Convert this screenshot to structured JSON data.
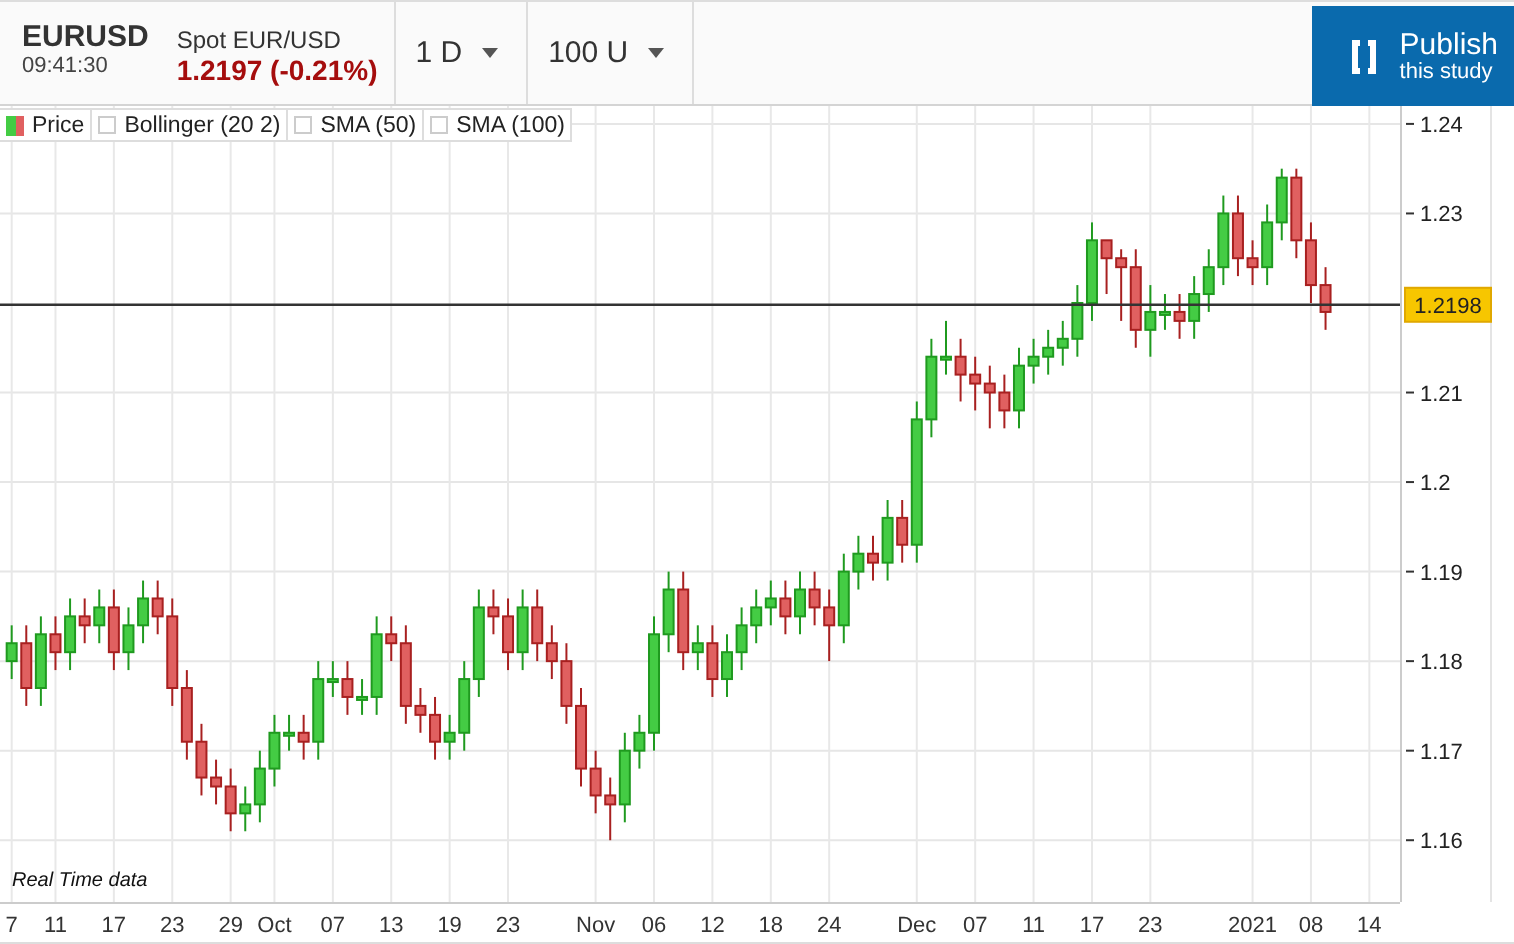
{
  "header": {
    "symbol": "EURUSD",
    "time": "09:41:30",
    "instrument": "Spot EUR/USD",
    "price": "1.2197 (-0.21%)",
    "dropdowns": [
      {
        "label": "1 D"
      },
      {
        "label": "100 U"
      }
    ],
    "publish_button": {
      "title": "Publish",
      "subtitle": "this study"
    }
  },
  "legend": [
    {
      "label": "Price",
      "kind": "swatch"
    },
    {
      "label": "Bollinger (20 2)",
      "kind": "checkbox",
      "checked": false
    },
    {
      "label": "SMA (50)",
      "kind": "checkbox",
      "checked": false
    },
    {
      "label": "SMA (100)",
      "kind": "checkbox",
      "checked": false
    }
  ],
  "chart": {
    "note": "Real Time data",
    "chart_data": {
      "type": "candlestick",
      "grid": true,
      "ylim": [
        1.1531,
        1.242
      ],
      "categories": [
        "7",
        null,
        null,
        "11",
        null,
        null,
        null,
        "17",
        null,
        null,
        null,
        "23",
        null,
        null,
        null,
        "29",
        null,
        null,
        "Oct",
        null,
        null,
        null,
        "07",
        null,
        null,
        null,
        "13",
        null,
        null,
        null,
        "19",
        null,
        null,
        null,
        "23",
        null,
        null,
        null,
        null,
        null,
        "Nov",
        null,
        null,
        null,
        "06",
        null,
        null,
        null,
        "12",
        null,
        null,
        null,
        "18",
        null,
        null,
        null,
        "24",
        null,
        null,
        null,
        null,
        null,
        "Dec",
        null,
        null,
        null,
        "07",
        null,
        null,
        null,
        "11",
        null,
        null,
        null,
        "17",
        null,
        null,
        null,
        "23",
        null,
        null,
        null,
        null,
        null,
        null,
        "2021",
        null,
        null,
        null,
        "08",
        null,
        null,
        null,
        "14"
      ],
      "ohlc": [
        [
          1.18,
          1.184,
          1.178,
          1.182
        ],
        [
          1.182,
          1.184,
          1.175,
          1.177
        ],
        [
          1.177,
          1.185,
          1.175,
          1.183
        ],
        [
          1.183,
          1.185,
          1.179,
          1.181
        ],
        [
          1.181,
          1.187,
          1.179,
          1.185
        ],
        [
          1.185,
          1.187,
          1.182,
          1.184
        ],
        [
          1.184,
          1.188,
          1.182,
          1.186
        ],
        [
          1.186,
          1.188,
          1.179,
          1.181
        ],
        [
          1.181,
          1.186,
          1.179,
          1.184
        ],
        [
          1.184,
          1.189,
          1.182,
          1.187
        ],
        [
          1.187,
          1.189,
          1.183,
          1.185
        ],
        [
          1.185,
          1.187,
          1.175,
          1.177
        ],
        [
          1.177,
          1.179,
          1.169,
          1.171
        ],
        [
          1.171,
          1.173,
          1.165,
          1.167
        ],
        [
          1.167,
          1.169,
          1.164,
          1.166
        ],
        [
          1.166,
          1.168,
          1.161,
          1.163
        ],
        [
          1.163,
          1.166,
          1.161,
          1.164
        ],
        [
          1.164,
          1.17,
          1.162,
          1.168
        ],
        [
          1.168,
          1.174,
          1.166,
          1.172
        ],
        [
          1.172,
          1.174,
          1.17,
          1.172
        ],
        [
          1.172,
          1.174,
          1.169,
          1.171
        ],
        [
          1.171,
          1.18,
          1.169,
          1.178
        ],
        [
          1.178,
          1.18,
          1.176,
          1.178
        ],
        [
          1.178,
          1.18,
          1.174,
          1.176
        ],
        [
          1.176,
          1.178,
          1.174,
          1.176
        ],
        [
          1.176,
          1.185,
          1.174,
          1.183
        ],
        [
          1.183,
          1.185,
          1.18,
          1.182
        ],
        [
          1.182,
          1.184,
          1.173,
          1.175
        ],
        [
          1.175,
          1.177,
          1.172,
          1.174
        ],
        [
          1.174,
          1.176,
          1.169,
          1.171
        ],
        [
          1.171,
          1.174,
          1.169,
          1.172
        ],
        [
          1.172,
          1.18,
          1.17,
          1.178
        ],
        [
          1.178,
          1.188,
          1.176,
          1.186
        ],
        [
          1.186,
          1.188,
          1.183,
          1.185
        ],
        [
          1.185,
          1.187,
          1.179,
          1.181
        ],
        [
          1.181,
          1.188,
          1.179,
          1.186
        ],
        [
          1.186,
          1.188,
          1.18,
          1.182
        ],
        [
          1.182,
          1.184,
          1.178,
          1.18
        ],
        [
          1.18,
          1.182,
          1.173,
          1.175
        ],
        [
          1.175,
          1.177,
          1.166,
          1.168
        ],
        [
          1.168,
          1.17,
          1.163,
          1.165
        ],
        [
          1.165,
          1.167,
          1.16,
          1.164
        ],
        [
          1.164,
          1.172,
          1.162,
          1.17
        ],
        [
          1.17,
          1.174,
          1.168,
          1.172
        ],
        [
          1.172,
          1.185,
          1.17,
          1.183
        ],
        [
          1.183,
          1.19,
          1.181,
          1.188
        ],
        [
          1.188,
          1.19,
          1.179,
          1.181
        ],
        [
          1.181,
          1.184,
          1.179,
          1.182
        ],
        [
          1.182,
          1.184,
          1.176,
          1.178
        ],
        [
          1.178,
          1.183,
          1.176,
          1.181
        ],
        [
          1.181,
          1.186,
          1.179,
          1.184
        ],
        [
          1.184,
          1.188,
          1.182,
          1.186
        ],
        [
          1.186,
          1.189,
          1.184,
          1.187
        ],
        [
          1.187,
          1.189,
          1.183,
          1.185
        ],
        [
          1.185,
          1.19,
          1.183,
          1.188
        ],
        [
          1.188,
          1.19,
          1.184,
          1.186
        ],
        [
          1.186,
          1.188,
          1.18,
          1.184
        ],
        [
          1.184,
          1.192,
          1.182,
          1.19
        ],
        [
          1.19,
          1.194,
          1.188,
          1.192
        ],
        [
          1.192,
          1.194,
          1.189,
          1.191
        ],
        [
          1.191,
          1.198,
          1.189,
          1.196
        ],
        [
          1.196,
          1.198,
          1.191,
          1.193
        ],
        [
          1.193,
          1.209,
          1.191,
          1.207
        ],
        [
          1.207,
          1.216,
          1.205,
          1.214
        ],
        [
          1.214,
          1.218,
          1.212,
          1.214
        ],
        [
          1.214,
          1.216,
          1.209,
          1.212
        ],
        [
          1.212,
          1.214,
          1.208,
          1.211
        ],
        [
          1.211,
          1.213,
          1.206,
          1.21
        ],
        [
          1.21,
          1.212,
          1.206,
          1.208
        ],
        [
          1.208,
          1.215,
          1.206,
          1.213
        ],
        [
          1.213,
          1.216,
          1.211,
          1.214
        ],
        [
          1.214,
          1.217,
          1.212,
          1.215
        ],
        [
          1.215,
          1.218,
          1.213,
          1.216
        ],
        [
          1.216,
          1.222,
          1.214,
          1.22
        ],
        [
          1.22,
          1.229,
          1.218,
          1.227
        ],
        [
          1.227,
          1.227,
          1.221,
          1.225
        ],
        [
          1.225,
          1.226,
          1.218,
          1.224
        ],
        [
          1.224,
          1.226,
          1.215,
          1.217
        ],
        [
          1.217,
          1.222,
          1.214,
          1.219
        ],
        [
          1.219,
          1.221,
          1.217,
          1.219
        ],
        [
          1.219,
          1.221,
          1.216,
          1.218
        ],
        [
          1.218,
          1.223,
          1.216,
          1.221
        ],
        [
          1.221,
          1.226,
          1.219,
          1.224
        ],
        [
          1.224,
          1.232,
          1.222,
          1.23
        ],
        [
          1.23,
          1.232,
          1.223,
          1.225
        ],
        [
          1.225,
          1.227,
          1.222,
          1.224
        ],
        [
          1.224,
          1.231,
          1.222,
          1.229
        ],
        [
          1.229,
          1.235,
          1.227,
          1.234
        ],
        [
          1.234,
          1.235,
          1.225,
          1.227
        ],
        [
          1.227,
          1.229,
          1.22,
          1.222
        ],
        [
          1.222,
          1.224,
          1.217,
          1.219
        ],
        null,
        null,
        null
      ],
      "yticks": [
        1.24,
        1.23,
        1.21,
        {
          "value": 1.2,
          "label": "1.2"
        },
        1.19,
        1.18,
        1.17,
        1.16
      ],
      "ref_lines": [
        {
          "axis": "y",
          "value": 1.2198,
          "label": "1.2198"
        }
      ]
    }
  }
}
